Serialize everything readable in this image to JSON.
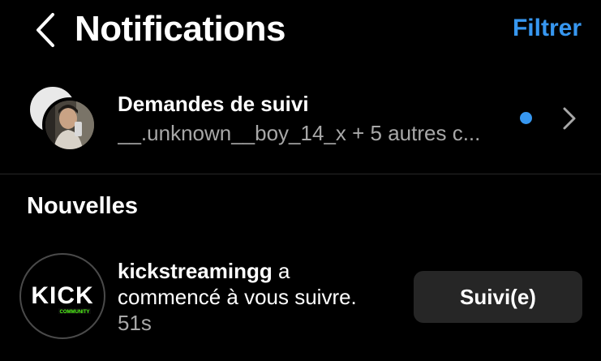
{
  "colors": {
    "accent": "#3797f0",
    "background": "#000000",
    "secondary_text": "#a8a8a8",
    "button_bg": "#262626"
  },
  "header": {
    "back_icon": "chevron-left-icon",
    "title": "Notifications",
    "filter_label": "Filtrer"
  },
  "follow_requests": {
    "title": "Demandes de suivi",
    "subtitle": "__.unknown__boy_14_x + 5 autres c...",
    "unread": true,
    "chevron_icon": "chevron-right-icon"
  },
  "sections": {
    "new_title": "Nouvelles"
  },
  "notifications": [
    {
      "username": "kickstreamingg",
      "message_tail": " a commencé à vous suivre.",
      "time": "51s",
      "avatar_logo_text": "KICK",
      "avatar_logo_subtext": "COMMUNITY",
      "button_label": "Suivi(e)"
    }
  ]
}
